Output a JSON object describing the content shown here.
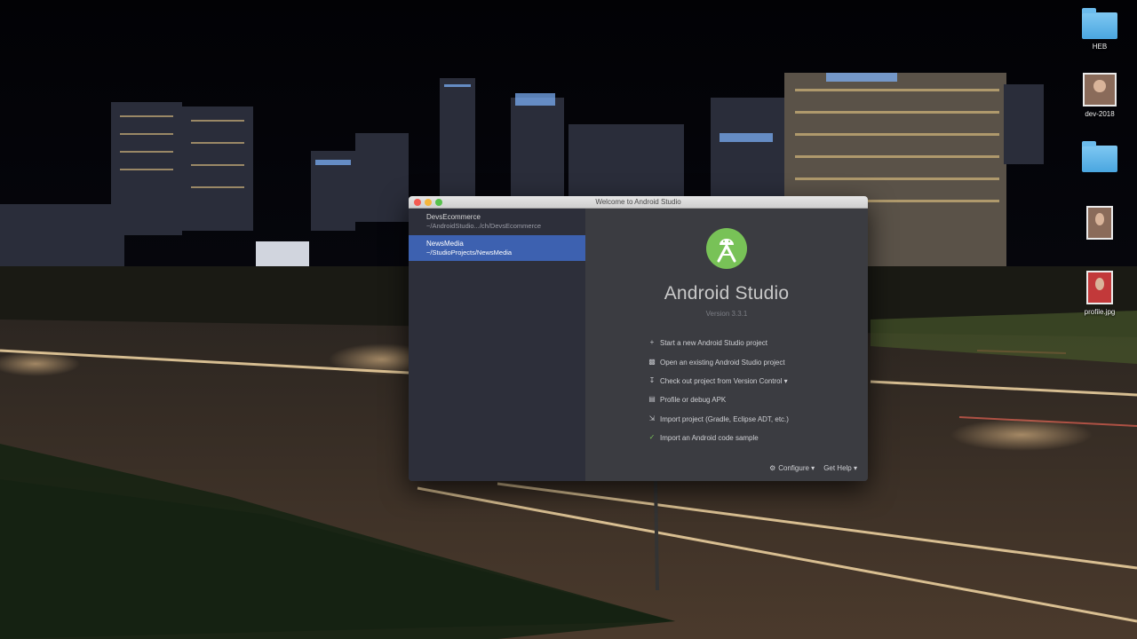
{
  "desktop": {
    "icons": [
      {
        "label": "HEB",
        "kind": "folder"
      },
      {
        "label": "dev-2018",
        "kind": "photo"
      },
      {
        "label": "",
        "kind": "folder"
      },
      {
        "label": "",
        "kind": "photo"
      },
      {
        "label": "profile.jpg",
        "kind": "photo"
      }
    ]
  },
  "window": {
    "title": "Welcome to Android Studio"
  },
  "recent_projects": [
    {
      "name": "DevsEcommerce",
      "path": "~/AndroidStudio.../ch/DevsEcommerce",
      "selected": false
    },
    {
      "name": "NewsMedia",
      "path": "~/StudioProjects/NewsMedia",
      "selected": true
    }
  ],
  "main": {
    "app_name": "Android Studio",
    "version": "Version 3.3.1",
    "actions": [
      {
        "label": "Start a new Android Studio project",
        "icon": "plus-icon"
      },
      {
        "label": "Open an existing Android Studio project",
        "icon": "folder-open-icon"
      },
      {
        "label": "Check out project from Version Control ▾",
        "icon": "vcs-checkout-icon"
      },
      {
        "label": "Profile or debug APK",
        "icon": "apk-icon"
      },
      {
        "label": "Import project (Gradle, Eclipse ADT, etc.)",
        "icon": "import-icon"
      },
      {
        "label": "Import an Android code sample",
        "icon": "code-sample-icon"
      }
    ],
    "configure_label": "Configure ▾",
    "get_help_label": "Get Help ▾"
  },
  "colors": {
    "accent_selection": "#3d61b0",
    "logo_green": "#78c257"
  }
}
